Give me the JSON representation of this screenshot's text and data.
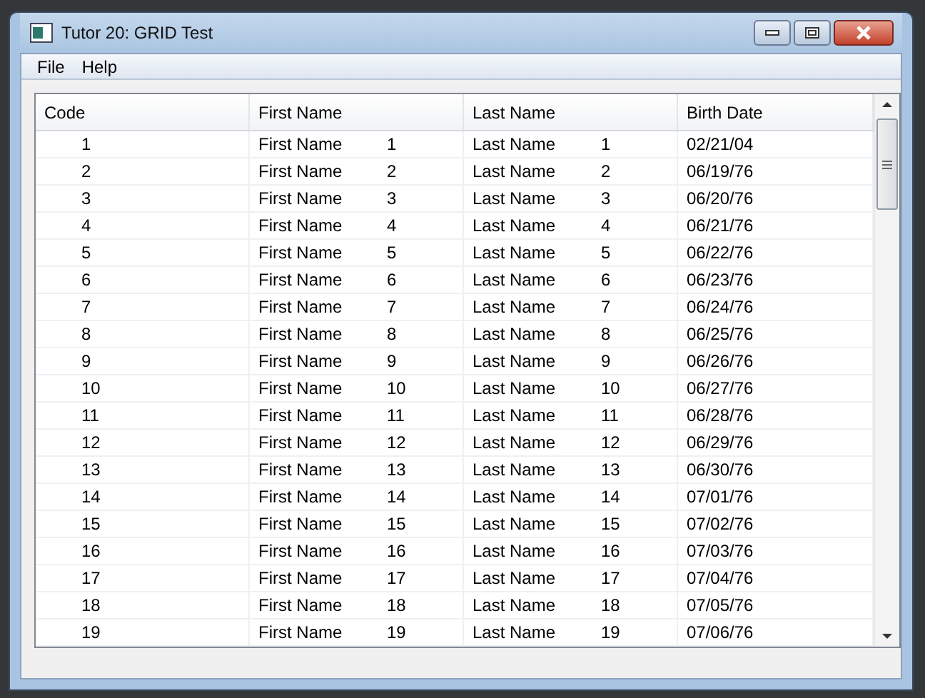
{
  "window": {
    "title": "Tutor 20: GRID Test"
  },
  "menu": [
    "File",
    "Help"
  ],
  "table": {
    "columns": [
      "Code",
      "First Name",
      "Last Name",
      "Birth Date"
    ],
    "rows": [
      {
        "code": "1",
        "first_name": "First Name",
        "first_number": "1",
        "last_name": "Last Name",
        "last_number": "1",
        "birth_date": "02/21/04"
      },
      {
        "code": "2",
        "first_name": "First Name",
        "first_number": "2",
        "last_name": "Last Name",
        "last_number": "2",
        "birth_date": "06/19/76"
      },
      {
        "code": "3",
        "first_name": "First Name",
        "first_number": "3",
        "last_name": "Last Name",
        "last_number": "3",
        "birth_date": "06/20/76"
      },
      {
        "code": "4",
        "first_name": "First Name",
        "first_number": "4",
        "last_name": "Last Name",
        "last_number": "4",
        "birth_date": "06/21/76"
      },
      {
        "code": "5",
        "first_name": "First Name",
        "first_number": "5",
        "last_name": "Last Name",
        "last_number": "5",
        "birth_date": "06/22/76"
      },
      {
        "code": "6",
        "first_name": "First Name",
        "first_number": "6",
        "last_name": "Last Name",
        "last_number": "6",
        "birth_date": "06/23/76"
      },
      {
        "code": "7",
        "first_name": "First Name",
        "first_number": "7",
        "last_name": "Last Name",
        "last_number": "7",
        "birth_date": "06/24/76"
      },
      {
        "code": "8",
        "first_name": "First Name",
        "first_number": "8",
        "last_name": "Last Name",
        "last_number": "8",
        "birth_date": "06/25/76"
      },
      {
        "code": "9",
        "first_name": "First Name",
        "first_number": "9",
        "last_name": "Last Name",
        "last_number": "9",
        "birth_date": "06/26/76"
      },
      {
        "code": "10",
        "first_name": "First Name",
        "first_number": "10",
        "last_name": "Last Name",
        "last_number": "10",
        "birth_date": "06/27/76"
      },
      {
        "code": "11",
        "first_name": "First Name",
        "first_number": "11",
        "last_name": "Last Name",
        "last_number": "11",
        "birth_date": "06/28/76"
      },
      {
        "code": "12",
        "first_name": "First Name",
        "first_number": "12",
        "last_name": "Last Name",
        "last_number": "12",
        "birth_date": "06/29/76"
      },
      {
        "code": "13",
        "first_name": "First Name",
        "first_number": "13",
        "last_name": "Last Name",
        "last_number": "13",
        "birth_date": "06/30/76"
      },
      {
        "code": "14",
        "first_name": "First Name",
        "first_number": "14",
        "last_name": "Last Name",
        "last_number": "14",
        "birth_date": "07/01/76"
      },
      {
        "code": "15",
        "first_name": "First Name",
        "first_number": "15",
        "last_name": "Last Name",
        "last_number": "15",
        "birth_date": "07/02/76"
      },
      {
        "code": "16",
        "first_name": "First Name",
        "first_number": "16",
        "last_name": "Last Name",
        "last_number": "16",
        "birth_date": "07/03/76"
      },
      {
        "code": "17",
        "first_name": "First Name",
        "first_number": "17",
        "last_name": "Last Name",
        "last_number": "17",
        "birth_date": "07/04/76"
      },
      {
        "code": "18",
        "first_name": "First Name",
        "first_number": "18",
        "last_name": "Last Name",
        "last_number": "18",
        "birth_date": "07/05/76"
      },
      {
        "code": "19",
        "first_name": "First Name",
        "first_number": "19",
        "last_name": "Last Name",
        "last_number": "19",
        "birth_date": "07/06/76"
      }
    ]
  }
}
